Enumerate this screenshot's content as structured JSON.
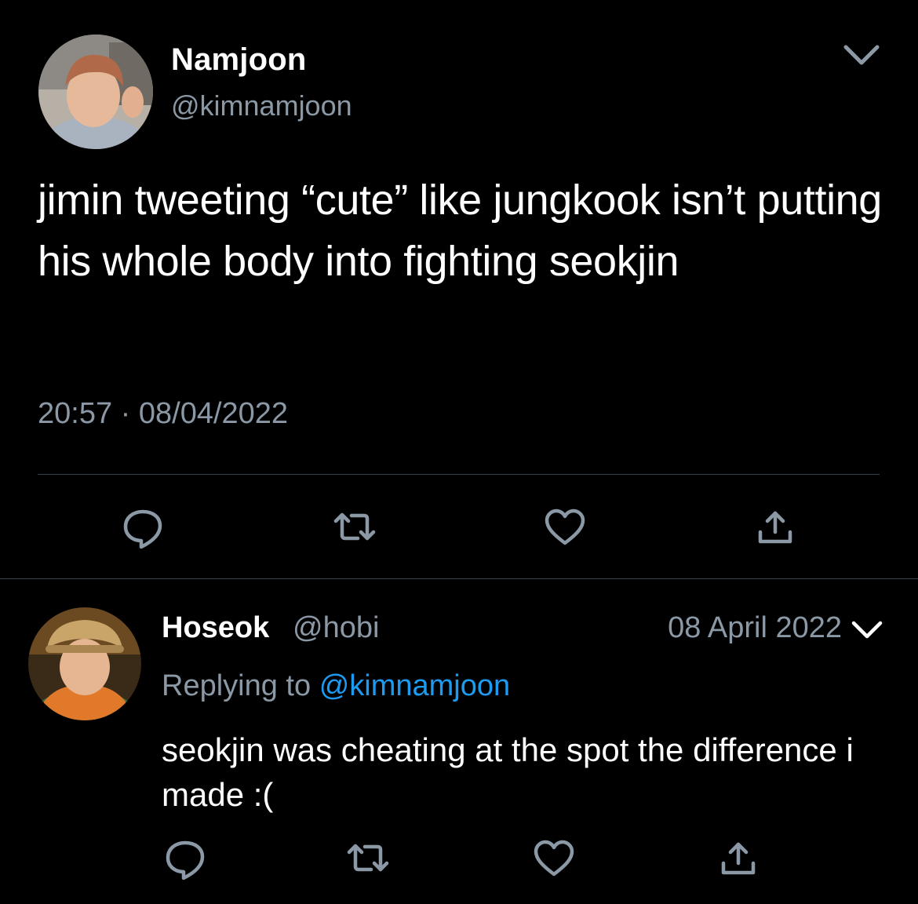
{
  "tweet": {
    "author": {
      "name": "Namjoon",
      "handle": "@kimnamjoon",
      "avatar_icon": "profile-photo"
    },
    "text": "jimin tweeting “cute” like jungkook isn’t putting his whole body into fighting seokjin",
    "time": "20:57",
    "separator": "·",
    "date": "08/04/2022",
    "actions": [
      "reply-icon",
      "retweet-icon",
      "like-icon",
      "share-icon"
    ],
    "menu_icon": "chevron-down-icon"
  },
  "reply": {
    "author": {
      "name": "Hoseok",
      "handle": "@hobi",
      "avatar_icon": "profile-photo"
    },
    "date": "08 April 2022",
    "replying_prefix": "Replying to",
    "replying_to": "@kimnamjoon",
    "text": "seokjin was cheating at the spot the difference i made :(",
    "actions": [
      "reply-icon",
      "retweet-icon",
      "like-icon",
      "share-icon"
    ],
    "menu_icon": "chevron-down-icon"
  },
  "colors": {
    "background": "#000000",
    "text_primary": "#ffffff",
    "text_secondary": "#8b98a5",
    "link": "#1d9bf0",
    "divider": "#38444d"
  }
}
